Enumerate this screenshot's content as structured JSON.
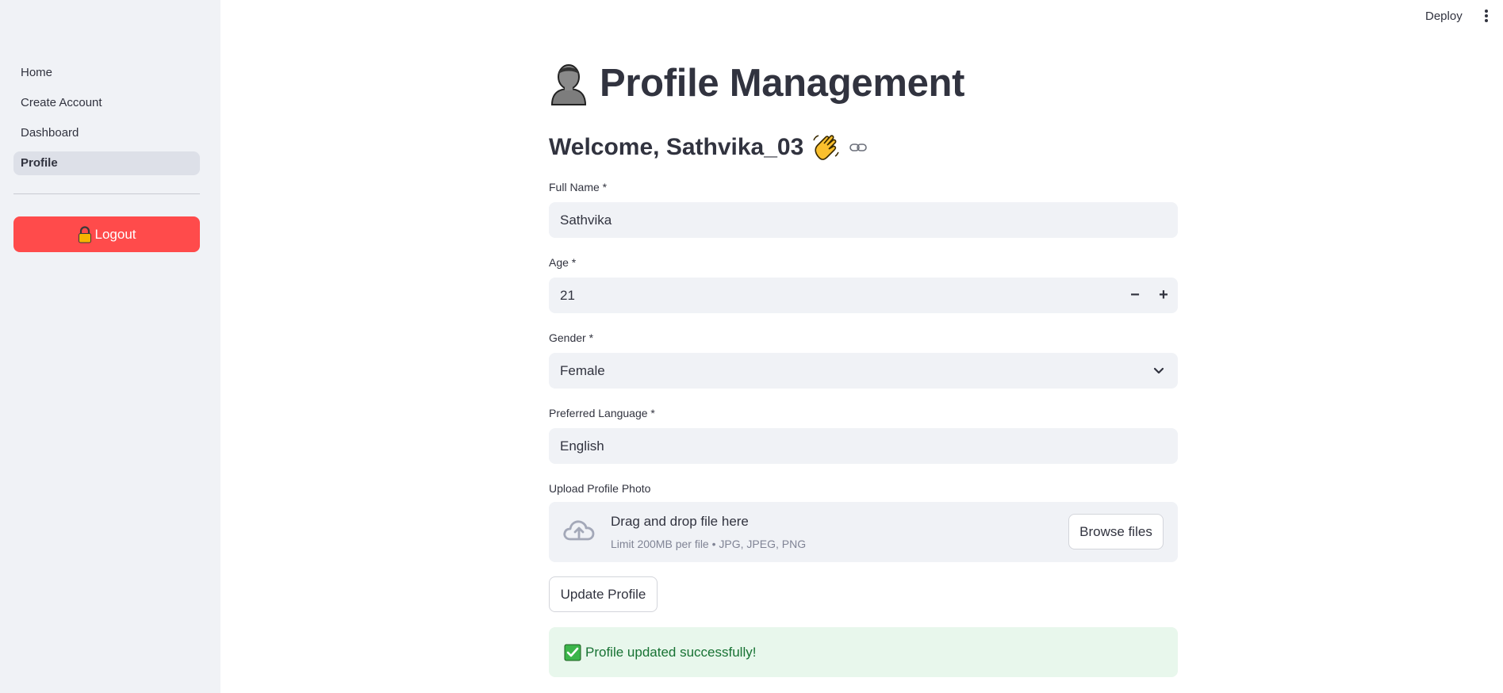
{
  "header": {
    "deploy_label": "Deploy",
    "menu_icon": "kebab-menu-icon"
  },
  "sidebar": {
    "items": [
      {
        "label": "Home",
        "active": false
      },
      {
        "label": "Create Account",
        "active": false
      },
      {
        "label": "Dashboard",
        "active": false
      },
      {
        "label": "Profile",
        "active": true
      }
    ],
    "logout_label": "Logout",
    "logout_icon": "lock-icon",
    "logout_color": "#ff4b4b"
  },
  "main": {
    "title": "Profile Management",
    "title_icon": "person-icon",
    "welcome": "Welcome, Sathvika_03",
    "welcome_icon": "waving-hand-icon",
    "anchor_icon": "link-icon",
    "fields": {
      "full_name": {
        "label": "Full Name *",
        "value": "Sathvika"
      },
      "age": {
        "label": "Age *",
        "value": "21",
        "minus": "−",
        "plus": "+"
      },
      "gender": {
        "label": "Gender *",
        "value": "Female"
      },
      "language": {
        "label": "Preferred Language *",
        "value": "English"
      }
    },
    "upload": {
      "label": "Upload Profile Photo",
      "drop_title": "Drag and drop file here",
      "drop_subtitle": "Limit 200MB per file • JPG, JPEG, PNG",
      "browse_label": "Browse files",
      "icon": "cloud-upload-icon"
    },
    "update_button": "Update Profile",
    "success_message": "Profile updated successfully!",
    "success_icon": "check-mark-icon"
  }
}
